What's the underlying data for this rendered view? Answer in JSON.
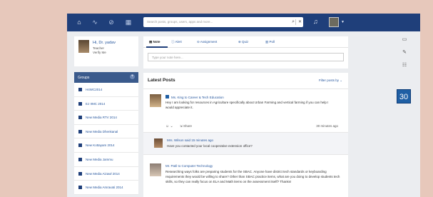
{
  "topbar": {
    "search_placeholder": "Search posts, groups, users, apps and more...",
    "nav_icons": [
      "home-icon",
      "activity-icon",
      "check-icon",
      "book-icon"
    ],
    "bell_icon": "bell-icon"
  },
  "profile": {
    "name": "Hi, Dr. yadav",
    "role": "Teacher",
    "verify": "Verify Me"
  },
  "groups": {
    "title": "Groups",
    "items": [
      {
        "label": "H4WC2014"
      },
      {
        "label": "EJ IIMC 2014"
      },
      {
        "label": "New Media RTV 2014"
      },
      {
        "label": "New Media Dhenkanal"
      },
      {
        "label": "New Kottayam 2014"
      },
      {
        "label": "New Media Jammu"
      },
      {
        "label": "New Media Aizawl 2014"
      },
      {
        "label": "New Media Amravati 2014"
      }
    ]
  },
  "composer": {
    "tabs": [
      "Note",
      "Alert",
      "Assignment",
      "Quiz",
      "Poll"
    ],
    "placeholder": "Type your note here..."
  },
  "feed": {
    "title": "Latest Posts",
    "filter_label": "Filter posts by",
    "posts": [
      {
        "author": "Ms. King to Career & Tech Education",
        "text": "Hey I am looking for resources in Agriculture specifically about Urban Farming and vertical farming if you can help I would appreciate it.",
        "share": "Share",
        "time": "30 minutes ago",
        "comment_author": "Mrs. Wilson said 15 minutes ago",
        "comment_text": "Have you contacted your local cooperative extension office?"
      },
      {
        "author": "Mr. Patil to Computer Technology",
        "text": "Researching ways folks are preparing students for the SBAC. Anyone have district tech standards or keyboarding requirements they would be willing to share? Other than SBAC practice items, what are you doing to develop students tech skills, so they can really focus on ELA and Math items on the assessment itself? Thanks!"
      }
    ]
  },
  "calendar": {
    "day": "30"
  },
  "accent_colors": {
    "topbar": "#1f3f7a",
    "link": "#27579e"
  }
}
